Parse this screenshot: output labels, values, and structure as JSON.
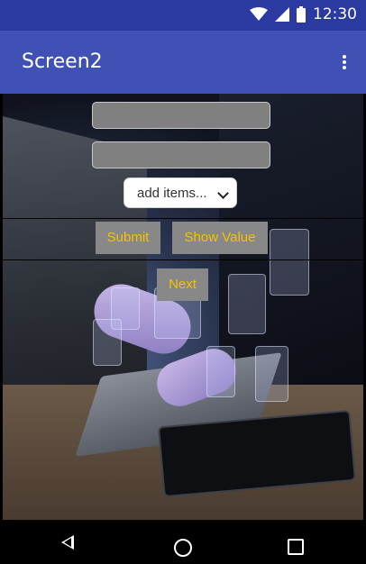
{
  "status_bar": {
    "time": "12:30",
    "icons": [
      "wifi-icon",
      "cell-signal-icon",
      "battery-icon"
    ]
  },
  "app_bar": {
    "title": "Screen2",
    "menu_icon": "overflow-menu-icon"
  },
  "form": {
    "textbox1_value": "",
    "textbox2_value": "",
    "spinner_label": "add items...",
    "submit_label": "Submit",
    "show_value_label": "Show Value",
    "next_label": "Next"
  },
  "nav_bar": {
    "icons": [
      "back-icon",
      "home-icon",
      "recents-icon"
    ]
  },
  "colors": {
    "app_bar": "#3f51b5",
    "status_bar": "#2a3aa0",
    "button_bg": "#888888",
    "button_text": "#f6c200"
  }
}
